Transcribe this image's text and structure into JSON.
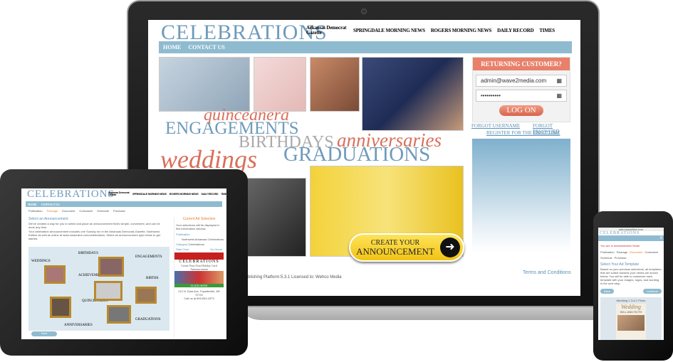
{
  "site": {
    "logo": "CELEBRATIONS",
    "papers": [
      "Arkansas Democrat Gazette",
      "SPRINGDALE MORNING NEWS",
      "ROGERS MORNING NEWS",
      "DAILY RECORD",
      "TIMES"
    ],
    "nav": [
      "HOME",
      "CONTACT US"
    ]
  },
  "desktop": {
    "words": {
      "quinceanera": "quinceanera",
      "engagements": "ENGAGEMENTS",
      "birthdays": "BIRTHDAYS",
      "anniversaries": "anniversaries",
      "weddings": "weddings",
      "graduations": "GRADUATIONS"
    },
    "login": {
      "title": "RETURNING CUSTOMER?",
      "username": "admin@wave2media.com",
      "password": "••••••••••",
      "button": "LOG ON",
      "forgot_username": "FORGOT USERNAME",
      "forgot_password": "FORGOT PASSWORD",
      "register": "REGISTER FOR THE FIRST TIME"
    },
    "cta_line1": "CREATE YOUR",
    "cta_line2": "ANNOUNCEMENT",
    "footer_left": "blishing Platform:5.3.1 Licensed to: Wehco Media",
    "footer_right": "Terms and Conditions"
  },
  "tablet": {
    "steps": [
      "Publication",
      "Package",
      "Document",
      "Customize",
      "Schedule",
      "Purchase"
    ],
    "active_step": "Package",
    "heading": "Select an Announcement",
    "para1": "We've created a way for you to select and place an announcement that's simple, convenient, and can be done any time.",
    "para2": "Your celebration announcement includes one Sunday run in the Arkansas Democrat-Gazette, Northwest Edition as well as online at www.nwaonline.com/celebrations. Select an announcement type below to get started.",
    "collage": [
      "WEDDINGS",
      "BIRTHDAYS",
      "ENGAGEMENTS",
      "ACHIEVEMENTS",
      "BIRTHS",
      "QUINCEANERA",
      "ANNIVERSARIES",
      "GRADUATIONS"
    ],
    "next": "Next",
    "side_title": "Current Ad Selection",
    "side_text": "Your selections will be displayed in this information window.",
    "publication_label": "Publication",
    "publication_value": "Northwest Arkansas Celebrations",
    "category_label": "Category",
    "category_value": "Celebrations",
    "start_over": "Start Over",
    "go_home": "Go Home",
    "ad_logo": "CELEBRATIONS",
    "ad_text": "Create Your Own Holiday Card Announcement",
    "ad_click": "CLICK HERE",
    "address": "212 N. East Ave. Fayetteville, AR 72701",
    "call": "Call us at 800.653.4373"
  },
  "phone": {
    "url": "ads.nwaonline.com",
    "logo": "CELEBRATIONS",
    "admin_mode": "You are in Administration Mode",
    "steps": [
      "Publication",
      "Package",
      "Document",
      "Customize",
      "Schedule",
      "Purchase"
    ],
    "active_step": "Document",
    "heading": "Select Your Ad Template",
    "text": "Based on your previous selections, all templates that are suited towards your needs are shown below. You will be able to customize each template with your images, logos, and wording in the next step.",
    "back": "Back",
    "continue": "Continue",
    "template_name": "Wedding 1 Col 1 Photo",
    "template_title": "Wedding",
    "template_sub": "WILL AND RUTH"
  },
  "colors": {
    "blue": "#8fbbd0",
    "logo": "#6f9bbb",
    "salmon": "#e8806a",
    "yellow": "#f6cf22"
  }
}
